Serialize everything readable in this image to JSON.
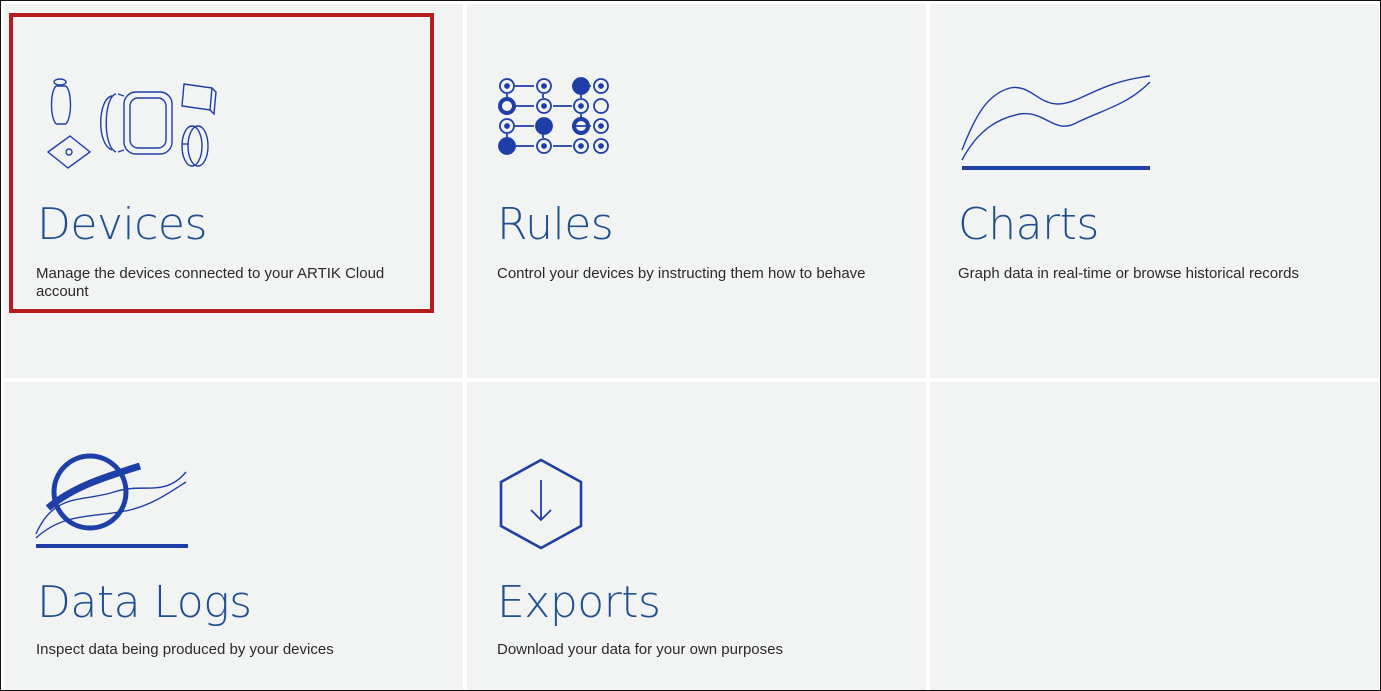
{
  "tiles": [
    {
      "title": "Devices",
      "description": "Manage the devices connected to your ARTIK Cloud account",
      "icon": "devices-icon",
      "highlighted": true
    },
    {
      "title": "Rules",
      "description": "Control your devices by instructing them how to behave",
      "icon": "rules-icon"
    },
    {
      "title": "Charts",
      "description": "Graph data in real-time or browse historical records",
      "icon": "charts-icon"
    },
    {
      "title": "Data Logs",
      "description": "Inspect data being produced by your devices",
      "icon": "data-logs-icon"
    },
    {
      "title": "Exports",
      "description": "Download your data for your own purposes",
      "icon": "exports-icon"
    }
  ],
  "colors": {
    "accent": "#1d4f91",
    "icon_stroke": "#1e3fa8",
    "highlight": "#b71c1c",
    "tile_bg": "#f2f3f3"
  }
}
